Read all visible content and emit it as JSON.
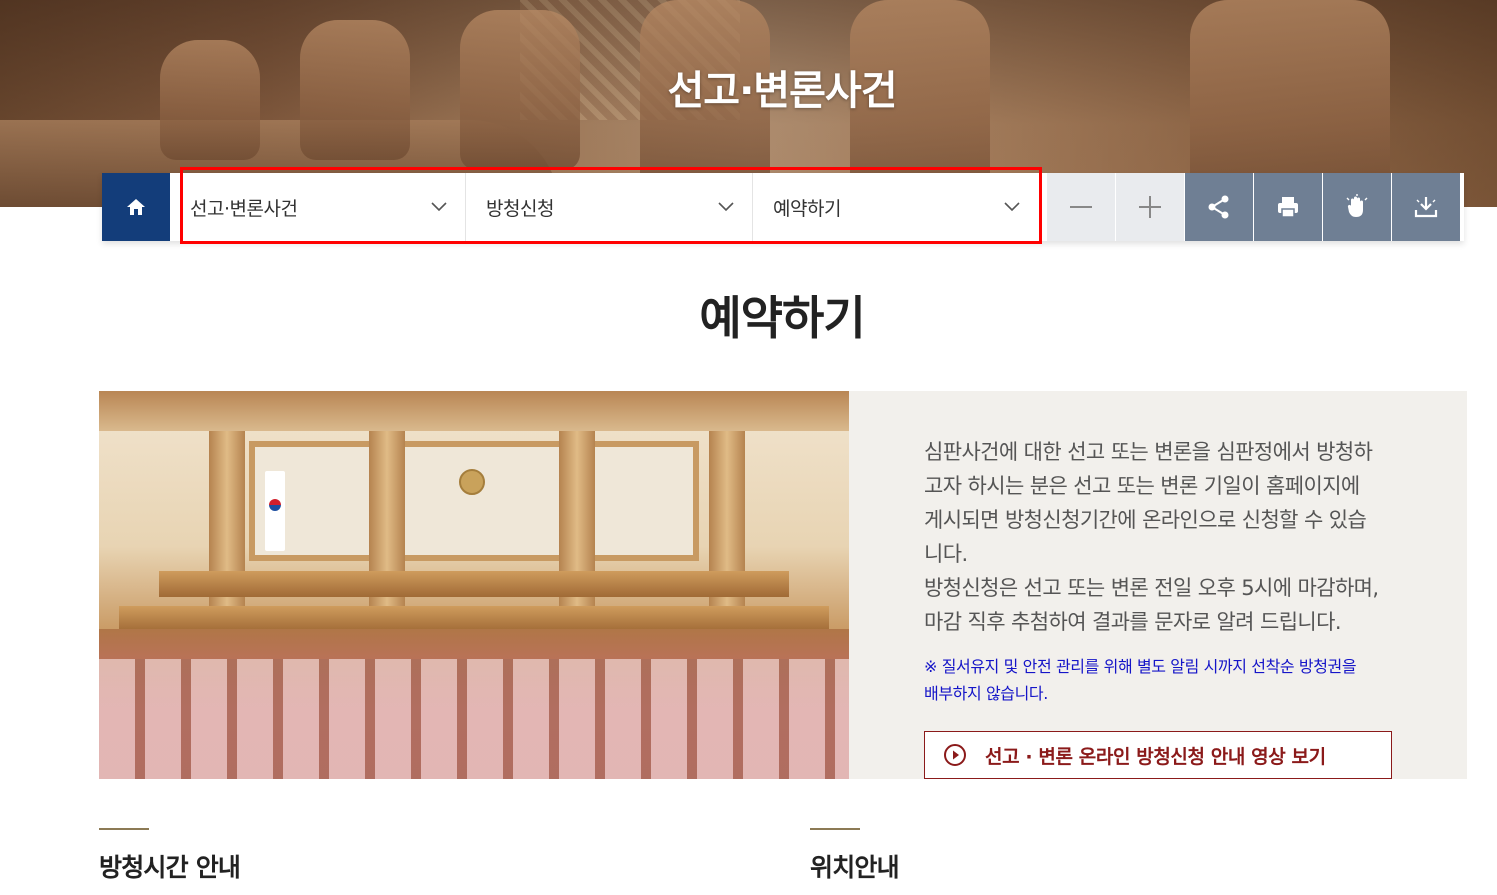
{
  "hero": {
    "title": "선고·변론사건"
  },
  "nav": {
    "home_icon": "home-icon",
    "breadcrumbs": [
      {
        "label": "선고·변론사건"
      },
      {
        "label": "방청신청"
      },
      {
        "label": "예약하기"
      }
    ],
    "tools": [
      {
        "name": "zoom-out",
        "icon": "minus-icon"
      },
      {
        "name": "zoom-in",
        "icon": "plus-icon"
      },
      {
        "name": "share",
        "icon": "share-icon"
      },
      {
        "name": "print",
        "icon": "print-icon"
      },
      {
        "name": "accessibility",
        "icon": "hand-icon"
      },
      {
        "name": "download",
        "icon": "download-icon"
      }
    ],
    "colors": {
      "home_bg": "#133d7a",
      "tool_light": "#e9ebee",
      "tool_dark": "#6f7f94",
      "highlight": "#ff0000"
    }
  },
  "page": {
    "title": "예약하기"
  },
  "intro": {
    "text_lines": [
      "심판사건에 대한 선고 또는 변론을 심판정에서 방청하",
      "고자 하시는 분은 선고 또는 변론 기일이 홈페이지에",
      "게시되면 방청신청기간에 온라인으로 신청할 수 있습",
      "니다.",
      "방청신청은 선고 또는 변론 전일 오후 5시에 마감하며,",
      "마감 직후 추첨하여 결과를 문자로 알려 드립니다."
    ],
    "note_lines": [
      "※ 질서유지 및 안전 관리를 위해 별도 알림 시까지 선착순 방청권을",
      "배부하지 않습니다."
    ],
    "video_button": {
      "label": "선고 · 변론 온라인 방청신청 안내 영상 보기",
      "icon": "play-circle-icon"
    }
  },
  "sections": {
    "hours": "방청시간 안내",
    "location": "위치안내"
  }
}
